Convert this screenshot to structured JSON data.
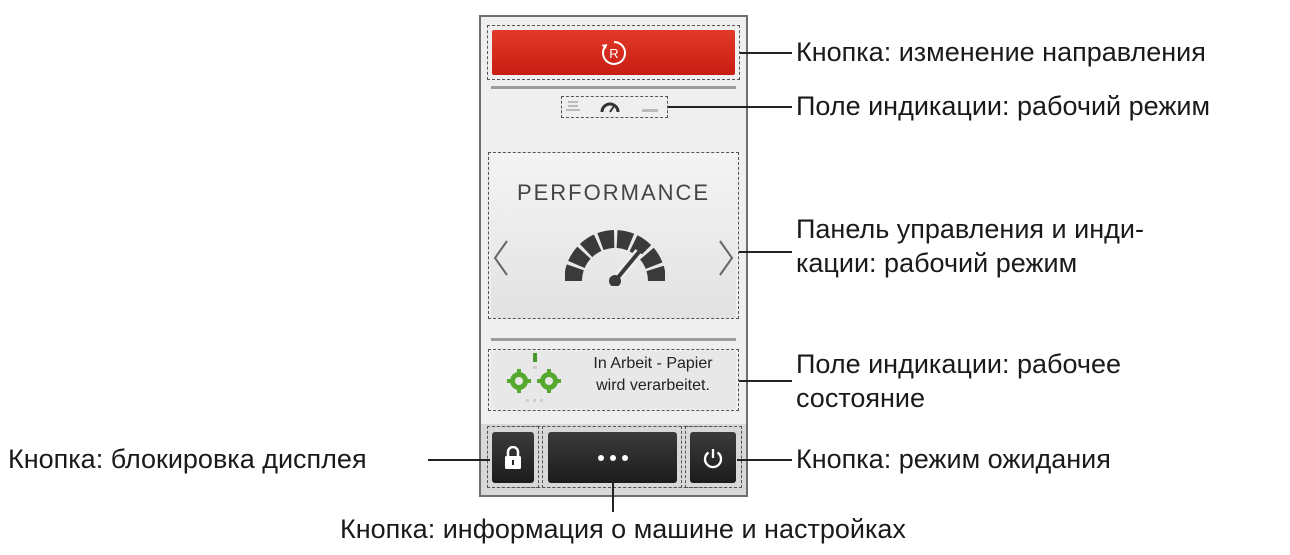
{
  "panel": {
    "mode_title": "PERFORMANCE",
    "status_line1": "In Arbeit - Papier",
    "status_line2": "wird verarbeitet.",
    "reverse_icon_letter": "R",
    "icons": [
      "reverse-icon",
      "mode-indicator-icon",
      "performance-gauge-icon",
      "arrow-left-icon",
      "arrow-right-icon",
      "gears-icon",
      "lock-icon",
      "more-dots-icon",
      "power-icon"
    ],
    "accent_color": "#d32a1e"
  },
  "callouts": {
    "reverse_button": "Кнопка: изменение направления",
    "mode_indicator": "Поле индикации: рабочий режим",
    "control_panel_line1": "Панель управления и инди-",
    "control_panel_line2": "кации: рабочий режим",
    "status_field_line1": "Поле индикации: рабочее",
    "status_field_line2": "состояние",
    "lock_button": "Кнопка: блокировка дисплея",
    "standby_button": "Кнопка: режим ожидания",
    "info_button": "Кнопка: информация о машине и настройках"
  }
}
